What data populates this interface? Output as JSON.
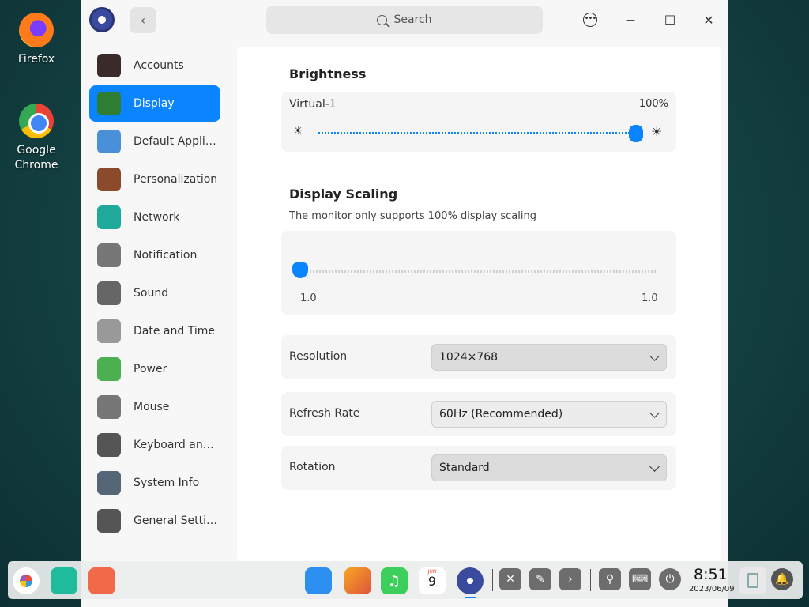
{
  "desktop": {
    "icons": [
      {
        "label": "Firefox"
      },
      {
        "label": "Google Chrome"
      }
    ]
  },
  "window": {
    "search_placeholder": "Search",
    "back_glyph": "‹",
    "more_glyph": "•••",
    "minimize_glyph": "—",
    "maximize_glyph": "☐",
    "close_glyph": "✕"
  },
  "sidebar": {
    "items": [
      {
        "label": "Accounts",
        "icon": "accounts-icon",
        "color": "#3a2a2a"
      },
      {
        "label": "Display",
        "icon": "display-icon",
        "color": "#2e7d32",
        "active": true
      },
      {
        "label": "Default Applic...",
        "icon": "default-apps-icon",
        "color": "#4a90d9"
      },
      {
        "label": "Personalization",
        "icon": "personalization-icon",
        "color": "#8b4a2b"
      },
      {
        "label": "Network",
        "icon": "network-icon",
        "color": "#1fa99a"
      },
      {
        "label": "Notification",
        "icon": "notification-bell-icon",
        "color": "#777777"
      },
      {
        "label": "Sound",
        "icon": "sound-speaker-icon",
        "color": "#666666"
      },
      {
        "label": "Date and Time",
        "icon": "clock-icon",
        "color": "#999999"
      },
      {
        "label": "Power",
        "icon": "battery-icon",
        "color": "#4caf50"
      },
      {
        "label": "Mouse",
        "icon": "mouse-icon",
        "color": "#777777"
      },
      {
        "label": "Keyboard and ...",
        "icon": "keyboard-icon",
        "color": "#555555"
      },
      {
        "label": "System Info",
        "icon": "system-info-icon",
        "color": "#556677"
      },
      {
        "label": "General Settin...",
        "icon": "gear-icon",
        "color": "#555555"
      }
    ]
  },
  "brightness": {
    "title": "Brightness",
    "monitor": "Virtual-1",
    "value_text": "100%",
    "level": 1.0
  },
  "scaling": {
    "title": "Display Scaling",
    "note": "The monitor only supports 100% display scaling",
    "min_label": "1.0",
    "max_label": "1.0"
  },
  "settings": {
    "resolution": {
      "label": "Resolution",
      "value": "1024×768"
    },
    "refresh": {
      "label": "Refresh Rate",
      "value": "60Hz (Recommended)"
    },
    "rotation": {
      "label": "Rotation",
      "value": "Standard"
    }
  },
  "taskbar": {
    "time": "8:51",
    "date": "2023/06/09",
    "calendar_day": "9",
    "calendar_month": "JUN",
    "accent": "#0a84ff"
  }
}
